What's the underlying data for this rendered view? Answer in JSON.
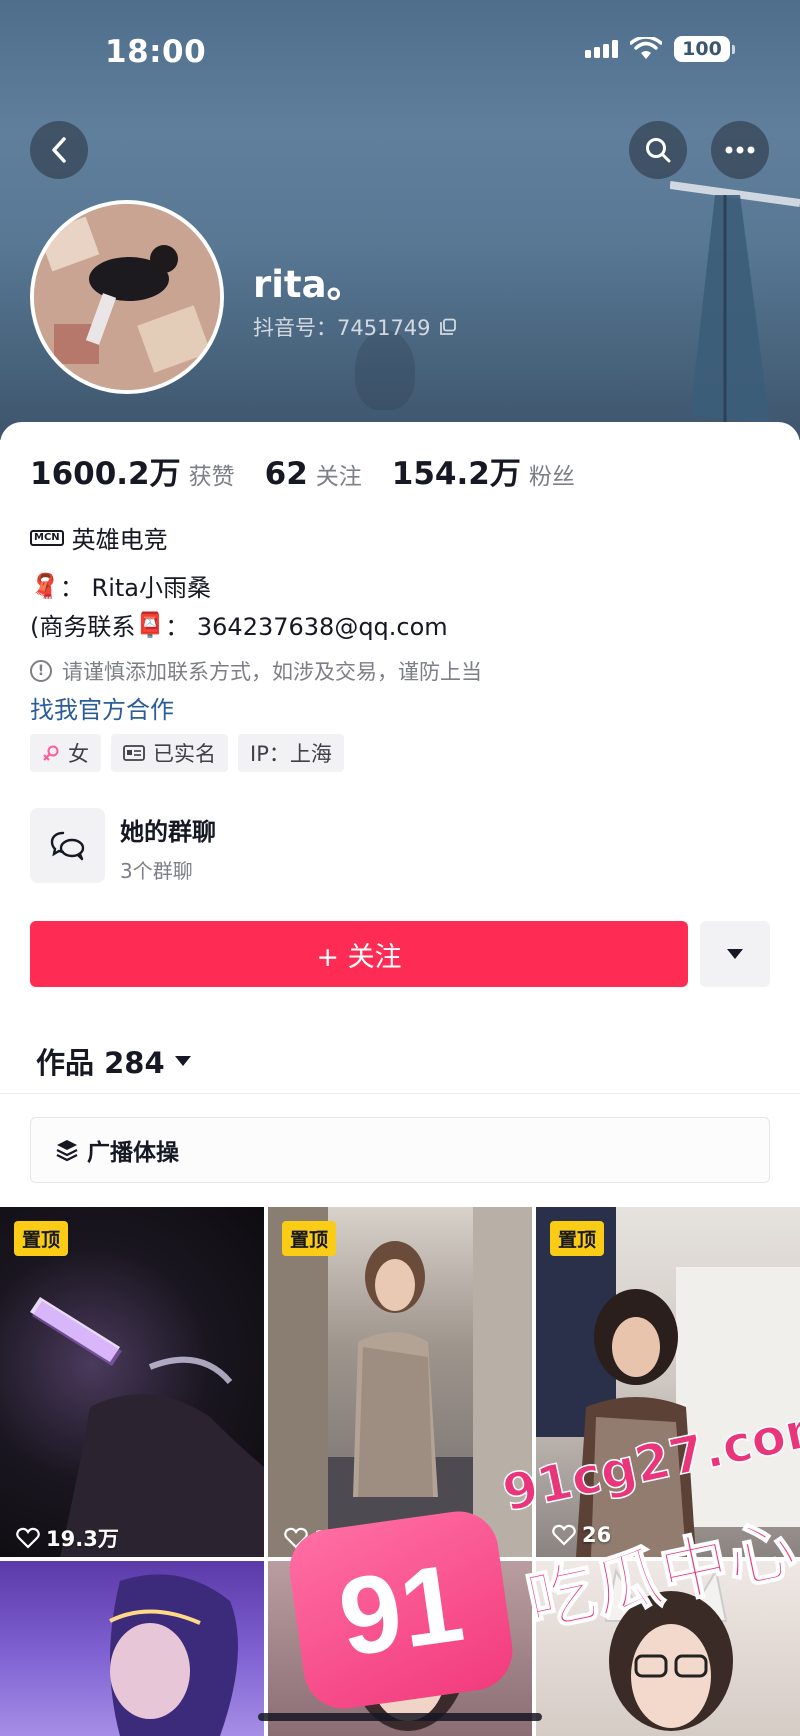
{
  "status_bar": {
    "time": "18:00",
    "battery": "100"
  },
  "profile": {
    "username": "rita。",
    "id_label": "抖音号：7451749",
    "stats": [
      {
        "value": "1600.2万",
        "label": "获赞"
      },
      {
        "value": "62",
        "label": "关注"
      },
      {
        "value": "154.2万",
        "label": "粉丝"
      }
    ],
    "mcn": {
      "badge": "MCN",
      "text": "英雄电竞"
    },
    "bio": {
      "line1_emoji": "🧣",
      "line1": "： Rita小雨桑",
      "line2_prefix": "(商务联系",
      "line2_emoji": "📮",
      "line2": "： 364237638@qq.com"
    },
    "warning": "请谨慎添加联系方式，如涉及交易，谨防上当",
    "cooperation_link": "找我官方合作",
    "tags": [
      {
        "icon": "female-icon",
        "text": "女"
      },
      {
        "icon": "id-card-icon",
        "text": "已实名"
      },
      {
        "icon": "",
        "text": "IP：上海"
      }
    ],
    "group_chat": {
      "title": "她的群聊",
      "subtitle": "3个群聊"
    },
    "follow_button": "+ 关注",
    "works_tab": "作品 284",
    "collection_label": "广播体操"
  },
  "videos": [
    {
      "pinned": "置顶",
      "likes": "19.3万"
    },
    {
      "pinned": "置顶",
      "likes": "39.6万"
    },
    {
      "pinned": "置顶",
      "likes": "26"
    },
    {
      "pinned": "",
      "likes": ""
    },
    {
      "pinned": "",
      "likes": ""
    },
    {
      "pinned": "",
      "likes": ""
    }
  ],
  "watermark": {
    "badge": "91",
    "url": "91cg27.com",
    "text": "吃瓜中心"
  },
  "colors": {
    "accent": "#fe2c55",
    "link": "#2b5d99",
    "pin": "#facc15"
  }
}
